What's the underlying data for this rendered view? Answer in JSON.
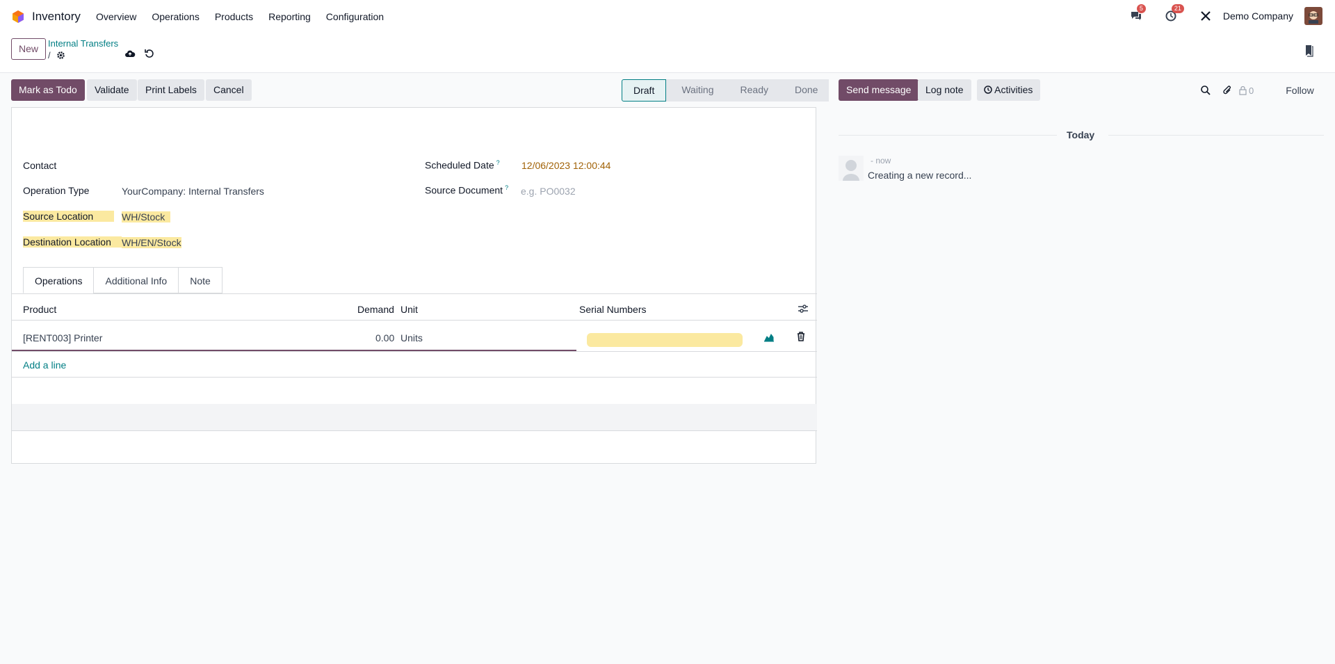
{
  "navbar": {
    "app_name": "Inventory",
    "menu": [
      "Overview",
      "Operations",
      "Products",
      "Reporting",
      "Configuration"
    ],
    "messages_badge": "5",
    "activities_badge": "21",
    "company": "Demo Company"
  },
  "control": {
    "new_label": "New",
    "breadcrumb": "Internal Transfers",
    "breadcrumb_sep": "/"
  },
  "actions": {
    "mark_todo": "Mark as Todo",
    "validate": "Validate",
    "print_labels": "Print Labels",
    "cancel": "Cancel"
  },
  "status": [
    "Draft",
    "Waiting",
    "Ready",
    "Done"
  ],
  "form": {
    "contact_label": "Contact",
    "operation_type_label": "Operation Type",
    "operation_type_value": "YourCompany: Internal Transfers",
    "source_location_label": "Source Location",
    "source_location_value": "WH/Stock",
    "destination_location_label": "Destination Location",
    "destination_location_value": "WH/EN/Stock",
    "scheduled_date_label": "Scheduled Date",
    "scheduled_date_value": "12/06/2023 12:00:44",
    "source_document_label": "Source Document",
    "source_document_placeholder": "e.g. PO0032",
    "help_mark": "?"
  },
  "tabs": [
    "Operations",
    "Additional Info",
    "Note"
  ],
  "table": {
    "headers": {
      "product": "Product",
      "demand": "Demand",
      "unit": "Unit",
      "serial": "Serial Numbers"
    },
    "rows": [
      {
        "product": "[RENT003] Printer",
        "demand": "0.00",
        "unit": "Units"
      }
    ],
    "add_line": "Add a line"
  },
  "chatter": {
    "send_message": "Send message",
    "log_note": "Log note",
    "activities": "Activities",
    "followers_count": "0",
    "follow": "Follow",
    "today": "Today",
    "message_time": "- now",
    "message_text": "Creating a new record..."
  },
  "colors": {
    "primary": "#714B67",
    "link": "#017e84",
    "highlight": "#fbe9a0",
    "date": "#a16207"
  }
}
